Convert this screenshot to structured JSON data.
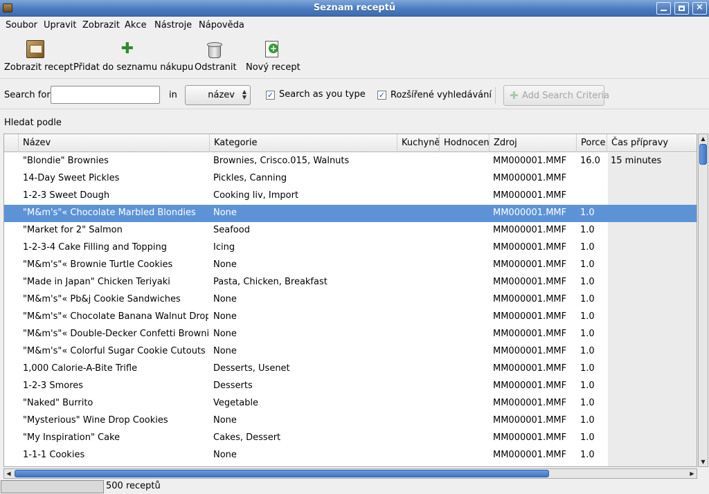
{
  "window": {
    "title": "Seznam receptů"
  },
  "menu": [
    "Soubor",
    "Upravit",
    "Zobrazit",
    "Akce",
    "Nástroje",
    "Nápověda"
  ],
  "toolbar": {
    "view_recipe": "Zobrazit recept",
    "add_to_shopping": "Přidat do seznamu nákupu",
    "delete": "Odstranit",
    "new_recipe": "Nový recept"
  },
  "search": {
    "label": "Search for",
    "value": "",
    "in_label": "in",
    "field_value": "název",
    "search_as_you_type": "Search as you type",
    "search_as_you_type_checked": true,
    "advanced": "Rozšířené vyhledávání",
    "advanced_checked": true,
    "add_criteria": "Add Search Criteria"
  },
  "search_by_label": "Hledat podle",
  "table": {
    "columns": [
      "Název",
      "Kategorie",
      "Kuchyně",
      "Hodnocení",
      "Zdroj",
      "Porce",
      "Čas přípravy"
    ],
    "selected_row": 3,
    "rows": [
      {
        "name": "\"Blondie\" Brownies",
        "category": "Brownies, Crisco.015, Walnuts",
        "cuisine": "",
        "rating": "",
        "source": "MM000001.MMF",
        "servings": "16.0",
        "prep_time": "15 minutes"
      },
      {
        "name": "14-Day Sweet Pickles",
        "category": "Pickles, Canning",
        "cuisine": "",
        "rating": "",
        "source": "MM000001.MMF",
        "servings": "",
        "prep_time": ""
      },
      {
        "name": "1-2-3 Sweet Dough",
        "category": "Cooking liv, Import",
        "cuisine": "",
        "rating": "",
        "source": "MM000001.MMF",
        "servings": "",
        "prep_time": ""
      },
      {
        "name": "\"M&m's\"« Chocolate Marbled Blondies",
        "category": "None",
        "cuisine": "",
        "rating": "",
        "source": "MM000001.MMF",
        "servings": "1.0",
        "prep_time": ""
      },
      {
        "name": "\"Market for 2\" Salmon",
        "category": "Seafood",
        "cuisine": "",
        "rating": "",
        "source": "MM000001.MMF",
        "servings": "1.0",
        "prep_time": ""
      },
      {
        "name": "1-2-3-4 Cake Filling and Topping",
        "category": "Icing",
        "cuisine": "",
        "rating": "",
        "source": "MM000001.MMF",
        "servings": "1.0",
        "prep_time": ""
      },
      {
        "name": "\"M&m's\"« Brownie Turtle Cookies",
        "category": "None",
        "cuisine": "",
        "rating": "",
        "source": "MM000001.MMF",
        "servings": "1.0",
        "prep_time": ""
      },
      {
        "name": "\"Made in Japan\" Chicken Teriyaki",
        "category": "Pasta, Chicken, Breakfast",
        "cuisine": "",
        "rating": "",
        "source": "MM000001.MMF",
        "servings": "1.0",
        "prep_time": ""
      },
      {
        "name": "\"M&m's\"« Pb&j Cookie Sandwiches",
        "category": "None",
        "cuisine": "",
        "rating": "",
        "source": "MM000001.MMF",
        "servings": "1.0",
        "prep_time": ""
      },
      {
        "name": "\"M&m's\"« Chocolate Banana Walnut Drops",
        "category": "None",
        "cuisine": "",
        "rating": "",
        "source": "MM000001.MMF",
        "servings": "1.0",
        "prep_time": ""
      },
      {
        "name": "\"M&m's\"« Double-Decker Confetti Brownies",
        "category": "None",
        "cuisine": "",
        "rating": "",
        "source": "MM000001.MMF",
        "servings": "1.0",
        "prep_time": ""
      },
      {
        "name": "\"M&m's\"« Colorful Sugar Cookie Cutouts",
        "category": "None",
        "cuisine": "",
        "rating": "",
        "source": "MM000001.MMF",
        "servings": "1.0",
        "prep_time": ""
      },
      {
        "name": "1,000 Calorie-A-Bite Trifle",
        "category": "Desserts, Usenet",
        "cuisine": "",
        "rating": "",
        "source": "MM000001.MMF",
        "servings": "1.0",
        "prep_time": ""
      },
      {
        "name": "1-2-3 Smores",
        "category": "Desserts",
        "cuisine": "",
        "rating": "",
        "source": "MM000001.MMF",
        "servings": "1.0",
        "prep_time": ""
      },
      {
        "name": "\"Naked\" Burrito",
        "category": "Vegetable",
        "cuisine": "",
        "rating": "",
        "source": "MM000001.MMF",
        "servings": "1.0",
        "prep_time": ""
      },
      {
        "name": "\"Mysterious\" Wine Drop Cookies",
        "category": "None",
        "cuisine": "",
        "rating": "",
        "source": "MM000001.MMF",
        "servings": "1.0",
        "prep_time": ""
      },
      {
        "name": "\"My Inspiration\" Cake",
        "category": "Cakes, Dessert",
        "cuisine": "",
        "rating": "",
        "source": "MM000001.MMF",
        "servings": "1.0",
        "prep_time": ""
      },
      {
        "name": "1-1-1 Cookies",
        "category": "None",
        "cuisine": "",
        "rating": "",
        "source": "MM000001.MMF",
        "servings": "1.0",
        "prep_time": ""
      }
    ]
  },
  "status": {
    "count": "500 receptů"
  },
  "colors": {
    "selection": "#5d93d6",
    "titlebar": "#4a7cc0"
  },
  "icons": [
    "app-icon",
    "minimize-icon",
    "maximize-icon",
    "close-icon",
    "recipe-book-icon",
    "plus-icon",
    "trash-icon",
    "new-document-icon",
    "add-criteria-icon",
    "chevron-up-down-icon"
  ]
}
